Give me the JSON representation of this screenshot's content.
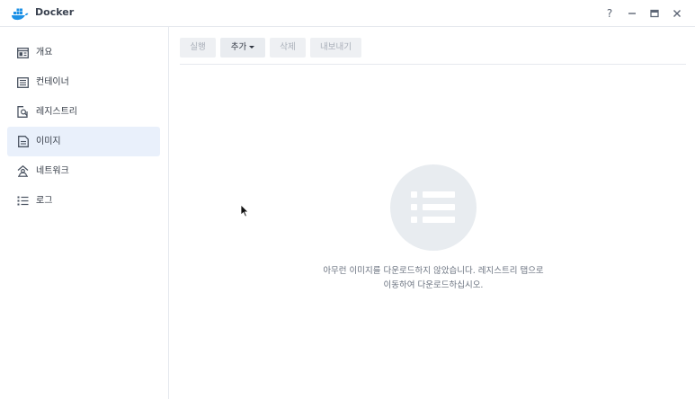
{
  "app": {
    "title": "Docker",
    "logo_icon": "docker-whale-icon",
    "brand_color": "#1d91e6"
  },
  "window_controls": {
    "help": "?",
    "minimize_icon": "minimize-icon",
    "maximize_icon": "maximize-icon",
    "close_icon": "close-icon"
  },
  "sidebar": {
    "active_color": "#e9f0fb",
    "items": [
      {
        "label": "개요",
        "icon": "overview-icon"
      },
      {
        "label": "컨테이너",
        "icon": "container-icon"
      },
      {
        "label": "레지스트리",
        "icon": "registry-search-icon"
      },
      {
        "label": "이미지",
        "icon": "image-icon",
        "active": true
      },
      {
        "label": "네트워크",
        "icon": "network-icon"
      },
      {
        "label": "로그",
        "icon": "log-list-icon"
      }
    ]
  },
  "toolbar": {
    "run_label": "실행",
    "add_label": "추가",
    "delete_label": "삭제",
    "export_label": "내보내기"
  },
  "empty_state": {
    "icon": "list-icon",
    "line1": "아무런 이미지를 다운로드하지 않았습니다. 레지스트리 탭으로",
    "line2": "이동하여 다운로드하십시오."
  }
}
